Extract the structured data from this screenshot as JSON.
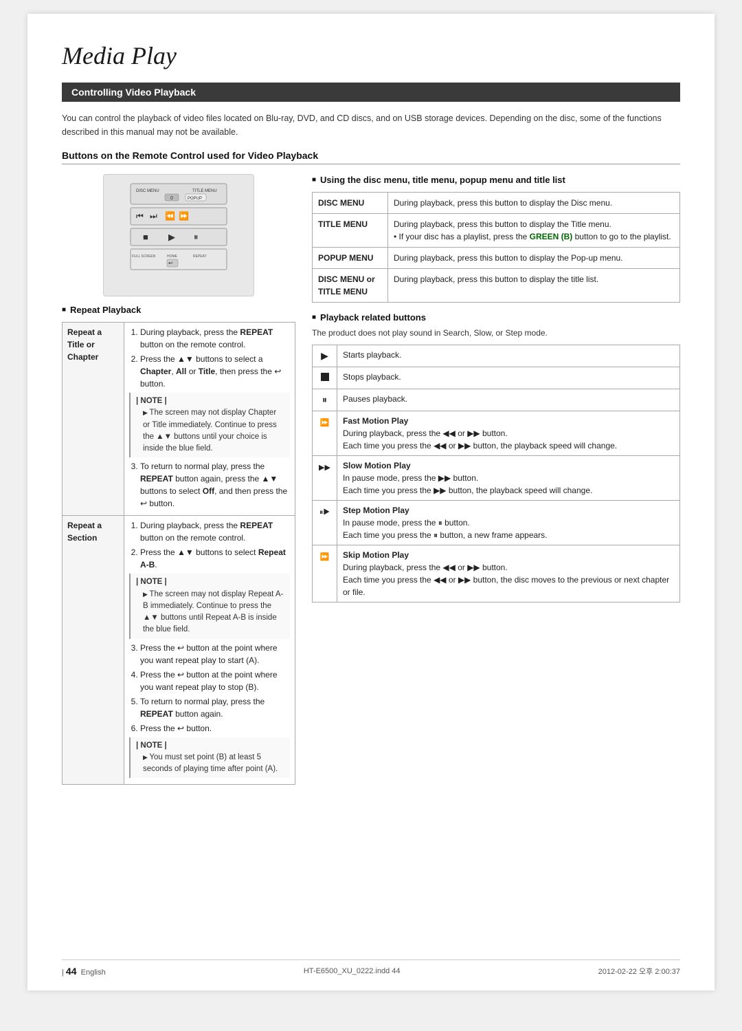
{
  "page": {
    "title": "Media Play",
    "section_header": "Controlling Video Playback",
    "intro": "You can control the playback of video files located on Blu-ray, DVD, and CD discs, and on USB storage devices. Depending on the disc, some of the functions described in this manual may not be available.",
    "buttons_subtitle": "Buttons on the Remote Control used for Video Playback",
    "repeat_playback_label": "Repeat Playback",
    "using_disc_menu_title": "Using the disc menu, title menu, popup menu and title list",
    "playback_related_title": "Playback related buttons",
    "playback_intro": "The product does not play sound in Search, Slow, or Step mode.",
    "left_rows": [
      {
        "label": "Repeat a Title or Chapter",
        "steps": [
          "During playback, press the REPEAT button on the remote control.",
          "Press the ▲▼ buttons to select a Chapter, All or Title, then press the 🔄 button.",
          "| NOTE |",
          "The screen may not display Chapter or Title immediately. Continue to press the ▲▼ buttons until your choice is inside the blue field.",
          "To return to normal play, press the REPEAT button again, press the ▲▼ buttons to select Off, and then press the 🔄 button."
        ]
      },
      {
        "label": "Repeat a Section",
        "steps": [
          "During playback, press the REPEAT button on the remote control.",
          "Press the ▲▼ buttons to select Repeat A-B.",
          "| NOTE |",
          "The screen may not display Repeat A-B immediately. Continue to press the ▲▼ buttons until  Repeat A-B  is inside the blue field.",
          "Press the 🔄 button at the point where you want repeat play to start (A).",
          "Press the 🔄 button at the point where you want repeat play to stop (B).",
          "To return to normal play, press the REPEAT button again.",
          "Press the 🔄 button.",
          "| NOTE |",
          "You must set point (B) at least 5 seconds of playing time after point (A)."
        ]
      }
    ],
    "disc_menu_rows": [
      {
        "label": "DISC MENU",
        "desc": "During playback, press this button to display the Disc menu."
      },
      {
        "label": "TITLE MENU",
        "desc": "During playback, press this button to display the Title menu.\n• If your disc has a playlist, press the GREEN (B) button to go to the playlist."
      },
      {
        "label": "POPUP MENU",
        "desc": "During playback, press this button to display the Pop-up menu."
      },
      {
        "label": "DISC MENU or TITLE MENU",
        "desc": "During playback, press this button to display the title list."
      }
    ],
    "playback_rows": [
      {
        "icon": "▶",
        "label": "",
        "desc": "Starts playback."
      },
      {
        "icon": "■",
        "label": "",
        "desc": "Stops playback."
      },
      {
        "icon": "⏸",
        "label": "",
        "desc": "Pauses playback."
      },
      {
        "icon": "⏩",
        "label": "Fast Motion Play",
        "desc": "During playback, press the ◀◀ or ▶▶ button.\nEach time you press the ◀◀ or ▶▶ button, the playback speed will change."
      },
      {
        "icon": "⏩",
        "label": "Slow Motion Play",
        "desc": "In pause mode, press the ▶▶ button.\nEach time you press the ▶▶ button, the playback speed will change."
      },
      {
        "icon": "⏸⏩",
        "label": "Step Motion Play",
        "desc": "In pause mode, press the ⏸ button.\nEach time you press the ⏸ button, a new frame appears."
      },
      {
        "icon": "⏩",
        "label": "Skip Motion Play",
        "desc": "During playback, press the ◀◀ or ▶▶ button.\nEach time you press the ◀◀ or ▶▶ button, the disc moves to the previous or next chapter or file."
      }
    ],
    "footer": {
      "page_number": "44",
      "page_label": "English",
      "file_ref": "HT-E6500_XU_0222.indd  44",
      "date_ref": "2012-02-22  오후 2:00:37"
    }
  }
}
